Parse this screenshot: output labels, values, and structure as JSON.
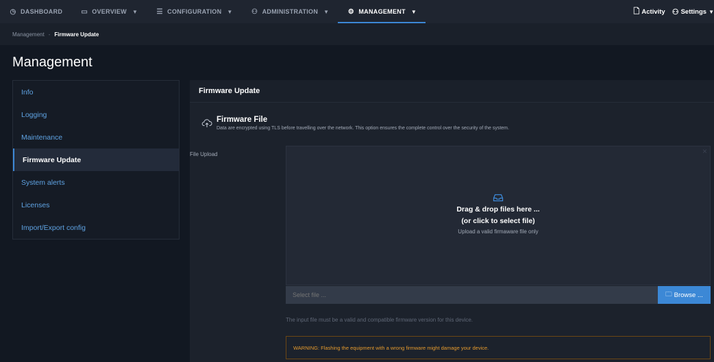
{
  "topnav": {
    "items": [
      {
        "label": "DASHBOARD",
        "icon": "dashboard-icon",
        "glyph": "◷"
      },
      {
        "label": "OVERVIEW",
        "icon": "monitor-icon",
        "glyph": "▭"
      },
      {
        "label": "CONFIGURATION",
        "icon": "list-icon",
        "glyph": "☰"
      },
      {
        "label": "ADMINISTRATION",
        "icon": "users-icon",
        "glyph": "⚇"
      },
      {
        "label": "MANAGEMENT",
        "icon": "gear-icon",
        "glyph": "⚙"
      }
    ],
    "active": "MANAGEMENT",
    "activity_label": "Activity",
    "settings_label": "Settings"
  },
  "breadcrumb": {
    "parent": "Management",
    "current": "Firmware Update"
  },
  "page": {
    "title": "Management"
  },
  "sidebar": {
    "items": [
      {
        "label": "Info"
      },
      {
        "label": "Logging"
      },
      {
        "label": "Maintenance"
      },
      {
        "label": "Firmware Update"
      },
      {
        "label": "System alerts"
      },
      {
        "label": "Licenses"
      },
      {
        "label": "Import/Export config"
      }
    ],
    "active_index": 3
  },
  "panel": {
    "header": "Firmware Update",
    "section_title": "Firmware File",
    "section_desc": "Data are encrypted using TLS before travelling over the network. This option ensures the complete control over the security of the system.",
    "upload_label": "File Upload",
    "dropzone": {
      "line1": "Drag & drop files here ...",
      "line2": "(or click to select file)",
      "line3": "Upload a valid firmaware file only"
    },
    "file_placeholder": "Select file ...",
    "browse_label": "Browse ...",
    "hint": "The input file must be a valid and compatible firmware version for this device.",
    "warning": "WARNING: Flashing the equipment with a wrong firmware might damage your device."
  },
  "colors": {
    "accent": "#3c88d6",
    "warning": "#e59a2d",
    "link": "#5fa3e3"
  }
}
